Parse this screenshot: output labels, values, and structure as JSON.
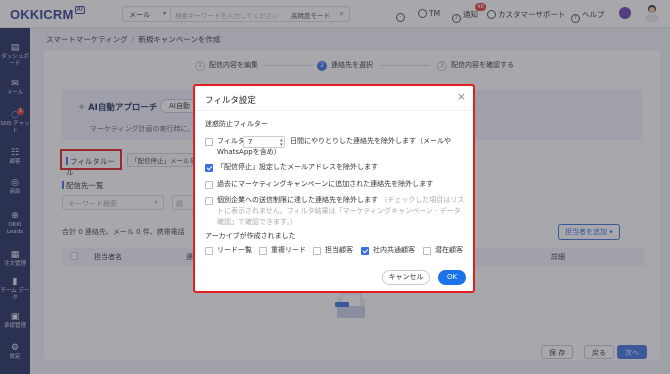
{
  "topbar": {
    "logo": "OKKICRM",
    "logo_ai": "AI",
    "search_type": "メール",
    "search_placeholder": "検索キーワードを入力してください",
    "search_mode": "高精度モード",
    "user_initials": "TM",
    "notifications_label": "通知",
    "notifications_count": "48",
    "support_label": "カスタマーサポート",
    "help_label": "ヘルプ"
  },
  "sidebar": {
    "items": [
      {
        "label": "ダッシュボード",
        "icon": "dashboard-icon"
      },
      {
        "label": "メール",
        "icon": "mail-icon"
      },
      {
        "label": "SNS チャット",
        "icon": "chat-icon",
        "badge": "1"
      },
      {
        "label": "顧客",
        "icon": "customer-icon"
      },
      {
        "label": "商談",
        "icon": "deal-icon"
      },
      {
        "label": "OKKI Leads",
        "icon": "leads-icon"
      },
      {
        "label": "注文管理",
        "icon": "order-icon"
      },
      {
        "label": "チーム データ",
        "icon": "team-data-icon"
      },
      {
        "label": "承認管理",
        "icon": "approval-icon"
      },
      {
        "label": "設定",
        "icon": "settings-icon"
      }
    ]
  },
  "breadcrumb": {
    "parent": "スマートマーケティング",
    "current": "新規キャンペーンを作成"
  },
  "steps": [
    {
      "num": "1",
      "label": "配信内容を編集"
    },
    {
      "num": "2",
      "label": "連絡先を選択"
    },
    {
      "num": "3",
      "label": "配信内容を確認する"
    }
  ],
  "ai": {
    "title": "AI自動アプローチ",
    "tag": "AI自動",
    "desc": "マーケティング計画の実行時に、"
  },
  "filter_tab": "フィルタルール",
  "stopmail_tag": "「配信停止」メールを除",
  "list": {
    "title": "配信先一覧",
    "keyword_placeholder": "キーワード検索",
    "select_placeholder": "顧",
    "summary": "合計 0 連絡先、メール 0 件、携帯電話",
    "add_owner": "担当者を追加"
  },
  "table": {
    "headers": [
      "担当者名",
      "連",
      "詳細"
    ]
  },
  "bottom": {
    "save": "保 存",
    "back": "戻る",
    "next": "次へ"
  },
  "modal": {
    "title": "フィルタ設定",
    "spam_section": "迷惑防止フィルター",
    "filter_label": "フィルタ",
    "filter_days": "7",
    "filter_desc": "日間にやりとりした連絡先を除外します（メールや",
    "filter_desc2": "WhatsAppを含め）",
    "opt_unsub": "「配信停止」設定したメールアドレスを除外します",
    "opt_added": "過去にマーケティングキャンペーンに追加された連絡先を除外します",
    "opt_limit": "個別企業への送信制限に達した連絡先を除外します",
    "opt_limit_note": "（チェックした項目はリストに表示されません。フィルタ結果は「マーケティングキャンペーン - データ確認」で確認できます。）",
    "archive_section": "アーカイブが作成されました",
    "archive_opts": [
      "リード一覧",
      "重複リード",
      "担当顧客",
      "社内共通顧客",
      "潜在顧客"
    ],
    "cancel": "キャンセル",
    "ok": "OK"
  }
}
